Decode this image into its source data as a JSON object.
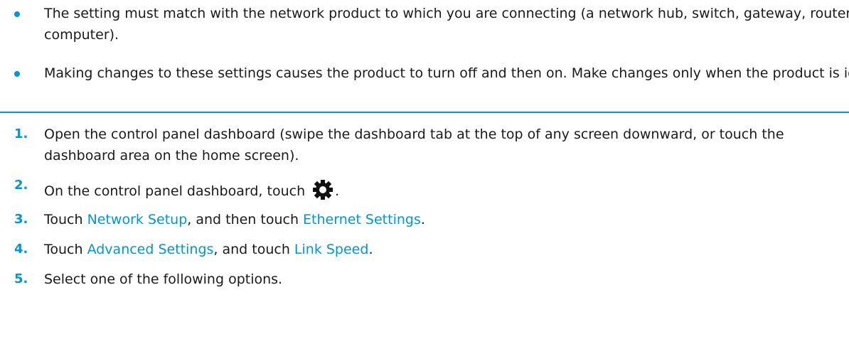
{
  "notes": [
    {
      "text": "The setting must match with the network product to which you are connecting (a network hub, switch, gateway, router, or computer)."
    },
    {
      "text": "Making changes to these settings causes the product to turn off and then on. Make changes only when the product is idle."
    }
  ],
  "steps": [
    {
      "num": "1.",
      "text": "Open the control panel dashboard (swipe the dashboard tab at the top of any screen downward, or touch the dashboard area on the home screen)."
    },
    {
      "num": "2.",
      "text_before": "On the control panel dashboard, touch",
      "icon": "gear-icon",
      "text_after": "."
    },
    {
      "num": "3.",
      "text_before": "Touch ",
      "link1": "Network Setup",
      "middle": ", and then touch ",
      "link2": "Ethernet Settings",
      "text_after": "."
    },
    {
      "num": "4.",
      "text_before": "Touch ",
      "link1": "Advanced Settings",
      "middle": ", and touch ",
      "link2": "Link Speed",
      "text_after": "."
    },
    {
      "num": "5.",
      "text": "Select one of the following options."
    }
  ],
  "colors": {
    "accent": "#0096d6",
    "text": "#1a1a1a"
  }
}
